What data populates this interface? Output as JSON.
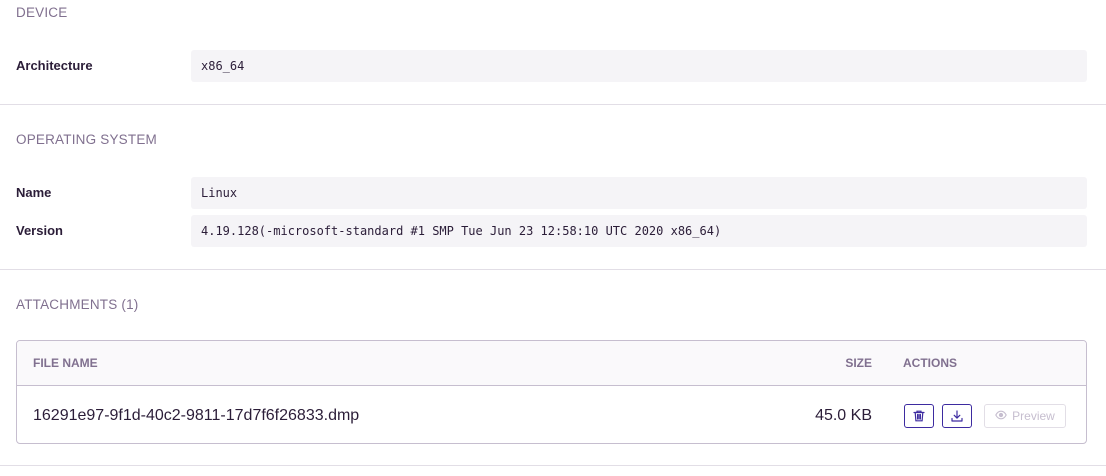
{
  "device": {
    "title": "DEVICE",
    "rows": [
      {
        "key": "Architecture",
        "value": "x86_64"
      }
    ]
  },
  "os": {
    "title": "OPERATING SYSTEM",
    "rows": [
      {
        "key": "Name",
        "value": "Linux"
      },
      {
        "key": "Version",
        "value": "4.19.128(-microsoft-standard #1 SMP Tue Jun 23 12:58:10 UTC 2020 x86_64)"
      }
    ]
  },
  "attachments": {
    "title": "ATTACHMENTS (1)",
    "columns": {
      "file_name": "FILE NAME",
      "size": "SIZE",
      "actions": "ACTIONS"
    },
    "rows": [
      {
        "file_name": "16291e97-9f1d-40c2-9811-17d7f6f26833.dmp",
        "size": "45.0 KB",
        "preview_label": "Preview"
      }
    ]
  },
  "icons": {
    "delete": "trash-icon",
    "download": "download-icon",
    "preview": "eye-icon"
  },
  "colors": {
    "accent": "#3d2ba0",
    "muted": "#80708f",
    "text": "#2b1d38",
    "value_bg": "#f5f4f7",
    "border": "#c6becf"
  }
}
